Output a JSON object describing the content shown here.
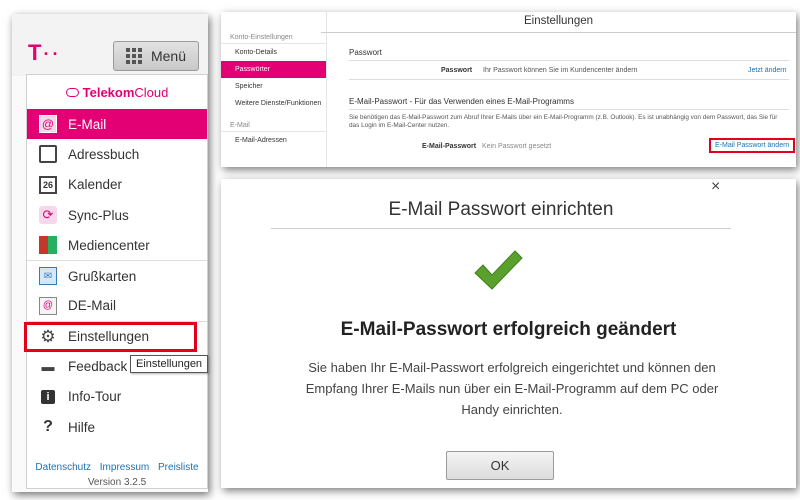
{
  "left": {
    "menu_button_label": "Menü",
    "cloud_brand": "Telekom",
    "cloud_brand_light": "Cloud",
    "items": [
      {
        "label": "E-Mail"
      },
      {
        "label": "Adressbuch"
      },
      {
        "label": "Kalender"
      },
      {
        "label": "Sync-Plus"
      },
      {
        "label": "Mediencenter"
      },
      {
        "label": "Grußkarten"
      },
      {
        "label": "DE-Mail"
      },
      {
        "label": "Einstellungen"
      },
      {
        "label": "Feedback"
      },
      {
        "label": "Info-Tour"
      },
      {
        "label": "Hilfe"
      }
    ],
    "tooltip": "Einstellungen",
    "footer": {
      "datenschutz": "Datenschutz",
      "impressum": "Impressum",
      "preisliste": "Preisliste"
    },
    "version": "Version 3.2.5",
    "calendar_day": "26"
  },
  "settings": {
    "title": "Einstellungen",
    "side": {
      "section1": "Konto-Einstellungen",
      "items1": [
        "Konto-Details",
        "Passwörter",
        "Speicher",
        "Weitere Dienste/Funktionen"
      ],
      "section2": "E-Mail",
      "items2": [
        "E-Mail-Adressen"
      ]
    },
    "passwort_head": "Passwort",
    "passwort_label": "Passwort",
    "passwort_text": "Ihr Passwort können Sie im Kundencenter ändern",
    "passwort_link": "Jetzt ändern",
    "email_head": "E-Mail-Passwort - Für das Verwenden eines E-Mail-Programms",
    "email_desc_1": "Sie benötigen das E-Mail-Passwort zum Abruf Ihrer E-Mails über ein E-Mail-Programm (z.B. Outlook). Es ist unabhängig von dem Passwort, das Sie für",
    "email_desc_2": "das Login im E-Mail-Center nutzen.",
    "email_label": "E-Mail-Passwort",
    "email_value": "Kein Passwort gesetzt",
    "email_link": "E-Mail Passwort ändern"
  },
  "dialog": {
    "close": "×",
    "title": "E-Mail Passwort einrichten",
    "success_head": "E-Mail-Passwort erfolgreich geändert",
    "success_text": "Sie haben Ihr E-Mail-Passwort erfolgreich eingerichtet und können den Empfang Ihrer E-Mails nun über ein E-Mail-Programm auf dem PC oder Handy einrichten.",
    "ok_label": "OK"
  },
  "colors": {
    "accent": "#e20074",
    "highlight": "#e3001b",
    "link": "#1a72b8",
    "success": "#5aa02c"
  },
  "icons": [
    "telekom-logo-icon",
    "grid-icon",
    "cloud-icon",
    "mail-icon",
    "address-book-icon",
    "calendar-icon",
    "sync-icon",
    "media-icon",
    "greeting-card-icon",
    "de-mail-icon",
    "gear-icon",
    "feedback-icon",
    "info-icon",
    "help-icon",
    "close-icon",
    "checkmark-icon"
  ]
}
